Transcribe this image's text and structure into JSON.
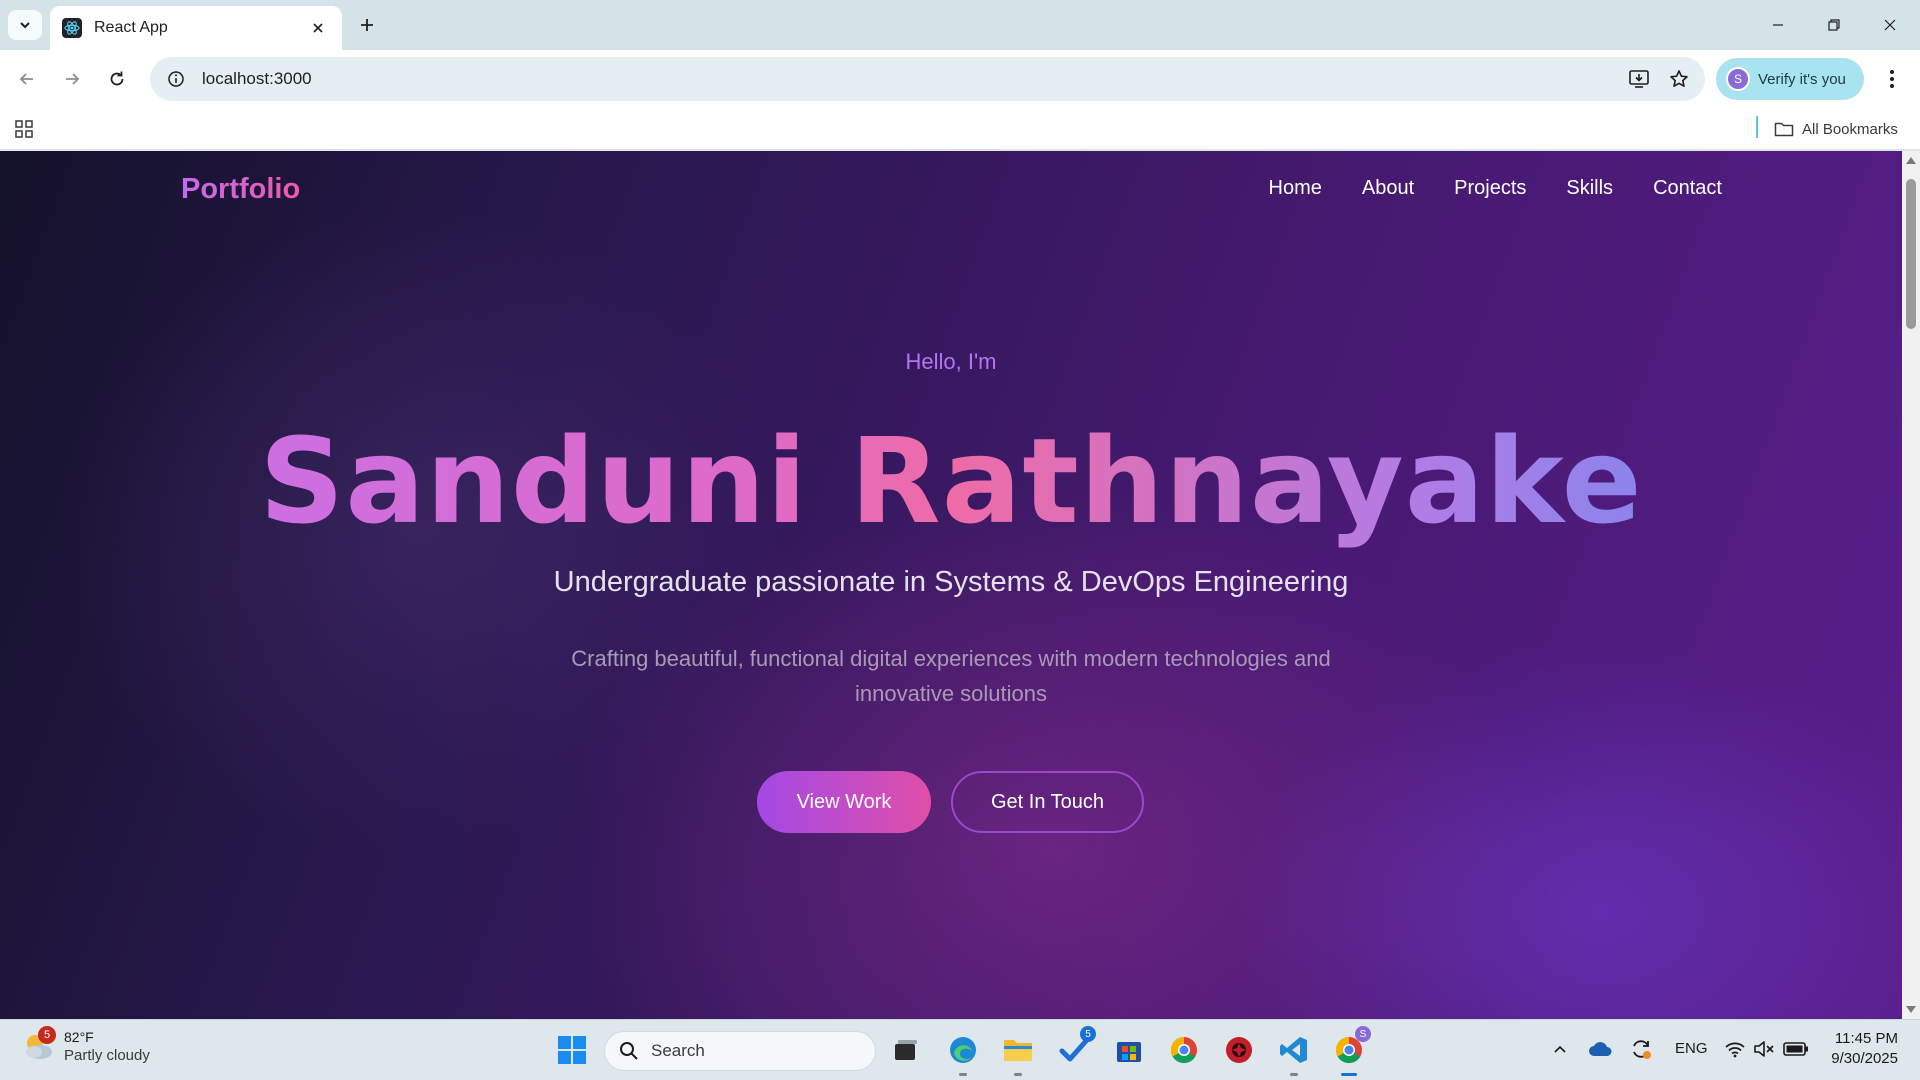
{
  "browser": {
    "tab_title": "React App",
    "url": "localhost:3000",
    "profile_label": "Verify it's you",
    "profile_initial": "S",
    "all_bookmarks_label": "All Bookmarks"
  },
  "site": {
    "logo": "Portfolio",
    "nav": [
      "Home",
      "About",
      "Projects",
      "Skills",
      "Contact"
    ],
    "hero": {
      "greeting": "Hello, I'm",
      "name": "Sanduni Rathnayake",
      "subtitle": "Undergraduate passionate in Systems & DevOps Engineering",
      "description": "Crafting beautiful, functional digital experiences with modern technologies and innovative solutions",
      "primary_button": "View Work",
      "secondary_button": "Get In Touch"
    }
  },
  "taskbar": {
    "weather_badge": "5",
    "weather_temp": "82°F",
    "weather_condition": "Partly cloudy",
    "search_placeholder": "Search",
    "todo_badge": "5",
    "chrome_profile_badge": "S",
    "language": "ENG",
    "time": "11:45 PM",
    "date": "9/30/2025"
  },
  "colors": {
    "brand_gradient_start": "#c26af2",
    "brand_gradient_end": "#e04fa8",
    "page_background": "#2a1850",
    "accent_blue": "#5e8ef2"
  },
  "icons": {
    "tab_favicon": "react-icon",
    "tab_search": "chevron-down-icon",
    "new_tab": "plus-icon",
    "back": "back-arrow-icon",
    "forward": "forward-arrow-icon",
    "reload": "reload-icon",
    "site_info": "info-icon",
    "install": "install-app-icon",
    "bookmark": "star-icon",
    "menu": "more-vert-icon",
    "apps": "apps-grid-icon",
    "folder": "folder-icon"
  }
}
